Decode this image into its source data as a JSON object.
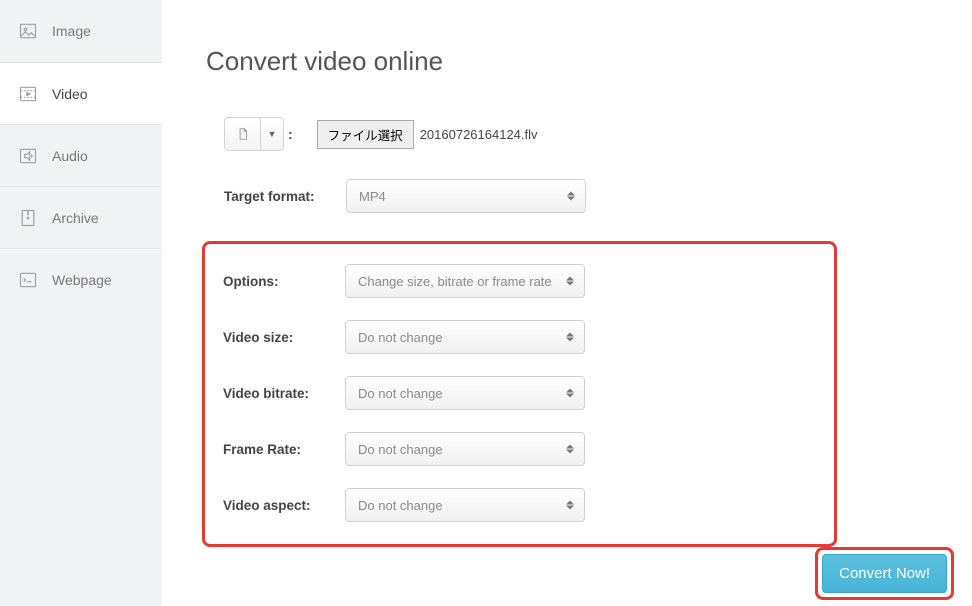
{
  "sidebar": {
    "items": [
      {
        "label": "Image"
      },
      {
        "label": "Video"
      },
      {
        "label": "Audio"
      },
      {
        "label": "Archive"
      },
      {
        "label": "Webpage"
      }
    ]
  },
  "page": {
    "title": "Convert video online"
  },
  "file": {
    "choose_label": "ファイル選択",
    "selected_name": "20160726164124.flv"
  },
  "form": {
    "target_format": {
      "label": "Target format:",
      "value": "MP4"
    },
    "options": {
      "label": "Options:",
      "value": "Change size, bitrate or frame rate"
    },
    "video_size": {
      "label": "Video size:",
      "value": "Do not change"
    },
    "video_bitrate": {
      "label": "Video bitrate:",
      "value": "Do not change"
    },
    "frame_rate": {
      "label": "Frame Rate:",
      "value": "Do not change"
    },
    "video_aspect": {
      "label": "Video aspect:",
      "value": "Do not change"
    }
  },
  "actions": {
    "convert": "Convert Now!"
  }
}
